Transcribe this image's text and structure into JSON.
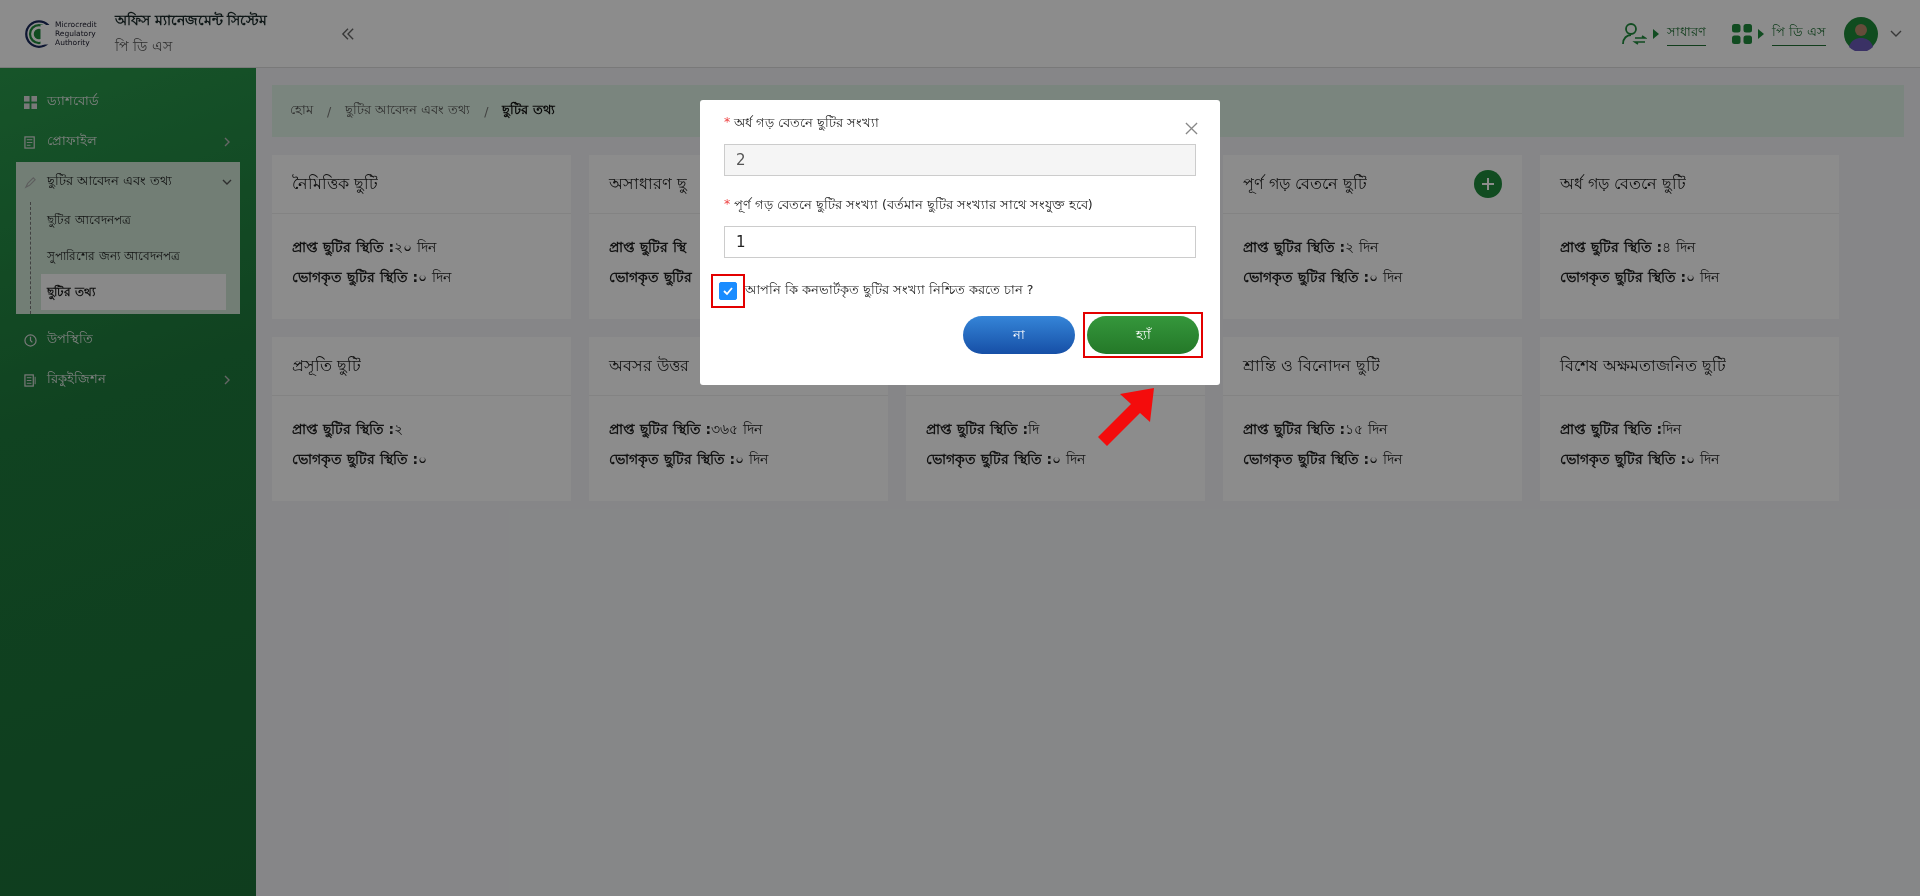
{
  "header": {
    "logo_lines": [
      "Microcredit",
      "Regulatory",
      "Authority"
    ],
    "app_title": "অফিস ম্যানেজমেন্ট সিস্টেম",
    "app_subtitle": "পি ডি এস",
    "role_link": "সাধারণ",
    "office_link": "পি ডি এস"
  },
  "sidebar": {
    "items": [
      {
        "label": "ড্যাশবোর্ড"
      },
      {
        "label": "প্রোফাইল",
        "expanded": false
      },
      {
        "label": "ছুটির আবেদন এবং তথ্য",
        "expanded": true,
        "children": [
          {
            "label": "ছুটির আবেদনপত্র",
            "selected": false
          },
          {
            "label": "সুপারিশের জন্য আবেদনপত্র",
            "selected": false
          },
          {
            "label": "ছুটির তথ্য",
            "selected": true
          }
        ]
      },
      {
        "label": "উপস্থিতি"
      },
      {
        "label": "রিকুইজিশন",
        "expanded": false
      }
    ]
  },
  "breadcrumb": {
    "separator": "/",
    "items": [
      "হোম",
      "ছুটির আবেদন এবং তথ্য",
      "ছুটির তথ্য"
    ]
  },
  "cards": [
    {
      "title": "নৈমিত্তিক ছুটি",
      "stats": [
        {
          "label": "প্রাপ্ত ছুটির স্থিতি :",
          "value": "২০ দিন"
        },
        {
          "label": "ভোগকৃত ছুটির স্থিতি :",
          "value": "০ দিন"
        }
      ]
    },
    {
      "title": "অসাধারণ ছু",
      "stats": [
        {
          "label": "প্রাপ্ত ছুটির স্থি"
        },
        {
          "label": "ভোগকৃত ছুটির"
        }
      ]
    },
    {
      "title": "পূর্ণ গড় বেতনে ছুটি",
      "add_button": true,
      "stats": [
        {
          "label": "প্রাপ্ত ছুটির স্থিতি :",
          "value": "২ দিন"
        },
        {
          "label": "ভোগকৃত ছুটির স্থিতি :",
          "value": "০ দিন"
        }
      ]
    },
    {
      "title": "অর্ধ গড় বেতনে ছুটি",
      "stats": [
        {
          "label": "প্রাপ্ত ছুটির স্থিতি :",
          "value": "৪ দিন"
        },
        {
          "label": "ভোগকৃত ছুটির স্থিতি :",
          "value": "০ দিন"
        }
      ]
    },
    {
      "title": "প্রসূতি ছুটি",
      "stats": [
        {
          "label": "প্রাপ্ত ছুটির স্থিতি :",
          "value": "২"
        },
        {
          "label": "ভোগকৃত ছুটির স্থিতি :",
          "value": "০"
        }
      ]
    },
    {
      "title": "অবসর উত্তর",
      "stats": [
        {
          "label": "প্রাপ্ত ছুটির স্থিতি :",
          "value": "৩৬৫ দিন"
        },
        {
          "label": "ভোগকৃত ছুটির স্থিতি :",
          "value": "০ দিন"
        }
      ]
    },
    {
      "stats": [
        {
          "label": "প্রাপ্ত ছুটির স্থিতি :",
          "value": "দি"
        },
        {
          "label": "ভোগকৃত ছুটির স্থিতি :",
          "value": "০ দিন"
        }
      ]
    },
    {
      "title": "শ্রান্তি ও বিনোদন ছুটি",
      "stats": [
        {
          "label": "প্রাপ্ত ছুটির স্থিতি :",
          "value": "১৫ দিন"
        },
        {
          "label": "ভোগকৃত ছুটির স্থিতি :",
          "value": "০ দিন"
        }
      ]
    },
    {
      "title": "বিশেষ অক্ষমতাজনিত ছুটি",
      "stats": [
        {
          "label": "প্রাপ্ত ছুটির স্থিতি :",
          "value": "দিন"
        },
        {
          "label": "ভোগকৃত ছুটির স্থিতি :",
          "value": "০ দিন"
        }
      ]
    }
  ],
  "modal": {
    "required_mark": "*",
    "fields": [
      {
        "label": "অর্ধ গড় বেতনে ছুটির সংখ্যা",
        "value": "2",
        "disabled": true
      },
      {
        "label": "পূর্ণ গড় বেতনে ছুটির সংখ্যা (বর্তমান ছুটির সংখ্যার সাথে সংযুক্ত হবে)",
        "value": "1",
        "disabled": false
      }
    ],
    "confirm": {
      "label": "আপনি কি কনভার্টকৃত ছুটির সংখ্যা নিশ্চিত করতে চান ?",
      "checked": true,
      "highlighted": true
    },
    "buttons": [
      {
        "label": "না",
        "kind": "cancel",
        "highlighted": false
      },
      {
        "label": "হ্যাঁ",
        "kind": "confirm",
        "highlighted": true
      }
    ],
    "pointer_arrow": true
  }
}
